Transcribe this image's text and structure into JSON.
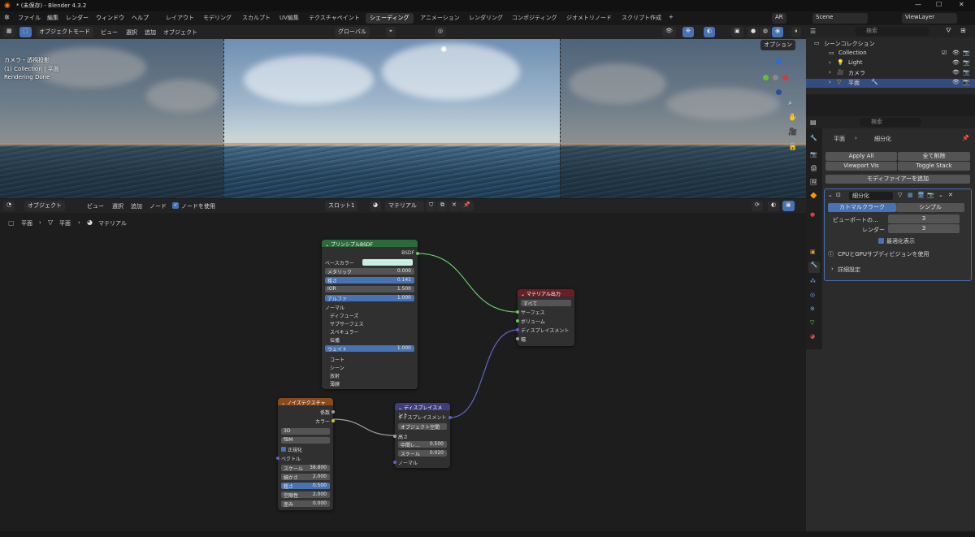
{
  "window": {
    "title": "* (未保存) - Blender 4.3.2"
  },
  "menu": [
    "ファイル",
    "編集",
    "レンダー",
    "ウィンドウ",
    "ヘルプ"
  ],
  "workspaces": [
    "レイアウト",
    "モデリング",
    "スカルプト",
    "UV編集",
    "テクスチャペイント",
    "シェーディング",
    "アニメーション",
    "レンダリング",
    "コンポジティング",
    "ジオメトリノード",
    "スクリプト作成"
  ],
  "active_workspace": "シェーディング",
  "topbar": {
    "render_engine": "AR",
    "scene": "Scene",
    "view_layer": "ViewLayer",
    "add_tab": "+"
  },
  "viewport": {
    "mode": "オブジェクトモード",
    "menus": [
      "ビュー",
      "選択",
      "追加",
      "オブジェクト"
    ],
    "transform": "グローバル",
    "options": "オプション",
    "overlay_info": [
      "カメラ・透視投影",
      "(1) Collection | 平面",
      "Rendering Done"
    ]
  },
  "outliner": {
    "search_placeholder": "検索",
    "root": "シーンコレクション",
    "collection": "Collection",
    "items": [
      "Light",
      "カメラ",
      "平面"
    ]
  },
  "properties": {
    "search_placeholder": "検索",
    "breadcrumb_object": "平面",
    "breadcrumb_modifier": "細分化",
    "apply_all": "Apply All",
    "delete_all": "全て削除",
    "viewport_vis": "Viewport Vis",
    "toggle_stack": "Toggle Stack",
    "add_modifier": "モディファイアーを追加",
    "modifier_name": "細分化",
    "tab_catmull": "カトマルクラーク",
    "tab_simple": "シンプル",
    "viewport_label": "ビューポートの...",
    "viewport_value": "3",
    "render_label": "レンダー",
    "render_value": "3",
    "optimal_display": "最適化表示",
    "gpu_subdiv": "CPUとGPUサブディビジョンを使用",
    "advanced": "詳細設定"
  },
  "node_editor": {
    "mode": "オブジェクト",
    "menus": [
      "ビュー",
      "選択",
      "追加",
      "ノード"
    ],
    "use_nodes": "ノードを使用",
    "slot": "スロット1",
    "material": "マテリアル",
    "breadcrumb": [
      "平面",
      "平面",
      "マテリアル"
    ]
  },
  "nodes": {
    "bsdf": {
      "title": "プリンシプルBSDF",
      "output": "BSDF",
      "base_color": "ベースカラー",
      "fields": [
        {
          "label": "メタリック",
          "value": "0.000"
        },
        {
          "label": "粗さ",
          "value": "0.141"
        },
        {
          "label": "IOR",
          "value": "1.500"
        },
        {
          "label": "アルファ",
          "value": "1.000"
        }
      ],
      "normal": "ノーマル",
      "panels": [
        "ディフューズ",
        "サブサーフェス",
        "スペキュラー"
      ],
      "transmission": "伝播",
      "weight_label": "ウェイト",
      "weight_value": "1.000",
      "panels2": [
        "コート",
        "シーン",
        "放射",
        "薄膜"
      ]
    },
    "output": {
      "title": "マテリアル出力",
      "target": "すべて",
      "inputs": [
        "サーフェス",
        "ボリューム",
        "ディスプレイスメント",
        "幅"
      ]
    },
    "noise": {
      "title": "ノイズテクスチャ",
      "outputs": [
        "係数",
        "カラー"
      ],
      "dim": "3D",
      "type": "fBM",
      "normalize": "正規化",
      "vector": "ベクトル",
      "fields": [
        {
          "label": "スケール",
          "value": "38.800"
        },
        {
          "label": "細かさ",
          "value": "2.000"
        },
        {
          "label": "粗さ",
          "value": "0.500"
        },
        {
          "label": "空隙性",
          "value": "2.000"
        },
        {
          "label": "歪み",
          "value": "0.000"
        }
      ]
    },
    "displacement": {
      "title": "ディスプレイスメント",
      "output": "ディスプレイスメント",
      "space": "オブジェクト空間",
      "height": "高さ",
      "fields": [
        {
          "label": "中間レ...",
          "value": "0.500"
        },
        {
          "label": "スケール",
          "value": "0.020"
        }
      ],
      "normal": "ノーマル"
    }
  },
  "colors": {
    "accent": "#4772b3",
    "bsdf_header": "#2b6b3a",
    "output_header": "#6a1f26",
    "noise_header": "#8a4a1c",
    "disp_header": "#3d3d80",
    "link_green": "#63c763",
    "link_purple": "#6363c7",
    "link_grey": "#a1a1a1"
  }
}
